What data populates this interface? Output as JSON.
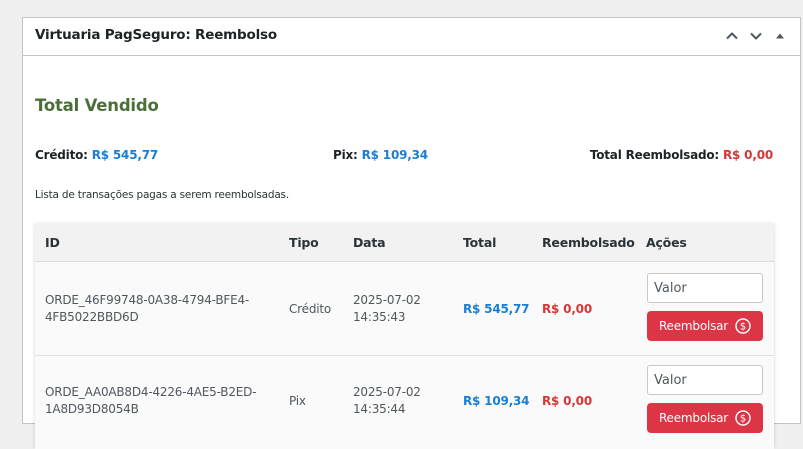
{
  "panel": {
    "title": "Virtuaria PagSeguro: Reembolso",
    "controls": [
      "chevron-up-icon",
      "chevron-down-icon",
      "triangle-up-icon"
    ]
  },
  "summary": {
    "heading": "Total Vendido",
    "credit_label": "Crédito:",
    "credit_value": "R$ 545,77",
    "pix_label": "Pix:",
    "pix_value": "R$ 109,34",
    "refunded_label": "Total Reembolsado:",
    "refunded_value": "R$ 0,00"
  },
  "list_caption": "Lista de transações pagas a serem reembolsadas.",
  "table": {
    "headers": [
      "ID",
      "Tipo",
      "Data",
      "Total",
      "Reembolsado",
      "Ações"
    ],
    "rows": [
      {
        "id_line1": "ORDE_46F99748-0A38-4794-BFE4-",
        "id_line2": "4FB5022BBD6D",
        "tipo": "Crédito",
        "date": "2025-07-02",
        "time": "14:35:43",
        "total": "R$ 545,77",
        "refunded": "R$ 0,00",
        "input_placeholder": "Valor",
        "button_label": "Reembolsar"
      },
      {
        "id_line1": "ORDE_AA0AB8D4-4226-4AE5-B2ED-",
        "id_line2": "1A8D93D8054B",
        "tipo": "Pix",
        "date": "2025-07-02",
        "time": "14:35:44",
        "total": "R$ 109,34",
        "refunded": "R$ 0,00",
        "input_placeholder": "Valor",
        "button_label": "Reembolsar"
      }
    ]
  },
  "colors": {
    "heading_green": "#4a7038",
    "value_blue": "#1a7fd4",
    "value_red": "#d63638",
    "button_red": "#dc3545"
  }
}
